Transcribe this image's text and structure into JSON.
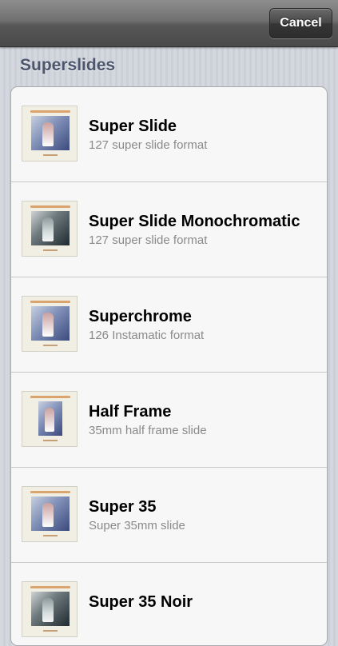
{
  "navbar": {
    "cancel_label": "Cancel"
  },
  "section": {
    "title": "Superslides"
  },
  "items": [
    {
      "title": "Super Slide",
      "subtitle": "127 super slide format",
      "thumb_style": "color"
    },
    {
      "title": "Super Slide Monochromatic",
      "subtitle": "127 super slide format",
      "thumb_style": "mono"
    },
    {
      "title": "Superchrome",
      "subtitle": "126 Instamatic format",
      "thumb_style": "color"
    },
    {
      "title": "Half Frame",
      "subtitle": "35mm half frame slide",
      "thumb_style": "half"
    },
    {
      "title": "Super 35",
      "subtitle": "Super 35mm slide",
      "thumb_style": "color"
    },
    {
      "title": "Super 35 Noir",
      "subtitle": "",
      "thumb_style": "mono"
    }
  ]
}
